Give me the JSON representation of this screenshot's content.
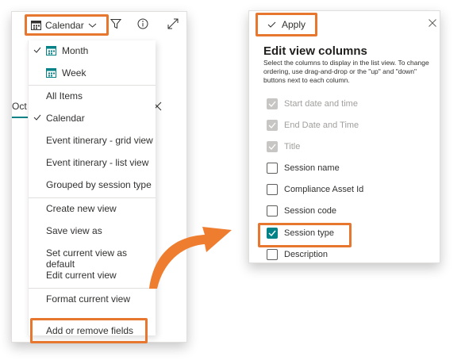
{
  "toolbar": {
    "view_label": "Calendar",
    "icons": [
      "calendar-icon",
      "chevron-down-icon",
      "filter-icon",
      "info-icon",
      "expand-icon"
    ]
  },
  "background": {
    "tab_label": "Oct"
  },
  "view_menu": {
    "items": [
      {
        "label": "Month",
        "checked": true,
        "icon": "calendar-icon"
      },
      {
        "label": "Week",
        "checked": false,
        "icon": "calendar-icon"
      },
      {
        "label": "All Items",
        "checked": false
      },
      {
        "label": "Calendar",
        "checked": true
      },
      {
        "label": "Event itinerary - grid view",
        "checked": false
      },
      {
        "label": "Event itinerary - list view",
        "checked": false
      },
      {
        "label": "Grouped by session type",
        "checked": false
      },
      {
        "label": "Create new view",
        "checked": false
      },
      {
        "label": "Save view as",
        "checked": false
      },
      {
        "label": "Set current view as default",
        "checked": false
      },
      {
        "label": "Edit current view",
        "checked": false
      },
      {
        "label": "Format current view",
        "checked": false
      },
      {
        "label": "Add or remove fields",
        "checked": false
      }
    ]
  },
  "edit_panel": {
    "apply_label": "Apply",
    "title": "Edit view columns",
    "description": "Select the columns to display in the list view. To change ordering, use drag-and-drop or the \"up\" and \"down\" buttons next to each column.",
    "columns": [
      {
        "label": "Start date and time",
        "state": "disabled-checked"
      },
      {
        "label": "End Date and Time",
        "state": "disabled-checked"
      },
      {
        "label": "Title",
        "state": "disabled-checked"
      },
      {
        "label": "Session name",
        "state": "unchecked"
      },
      {
        "label": "Compliance Asset Id",
        "state": "unchecked"
      },
      {
        "label": "Session code",
        "state": "unchecked"
      },
      {
        "label": "Session type",
        "state": "checked"
      },
      {
        "label": "Description",
        "state": "unchecked"
      }
    ]
  },
  "colors": {
    "highlight": "#e7762f",
    "accent": "#038387",
    "arrow": "#ef7d2f"
  }
}
